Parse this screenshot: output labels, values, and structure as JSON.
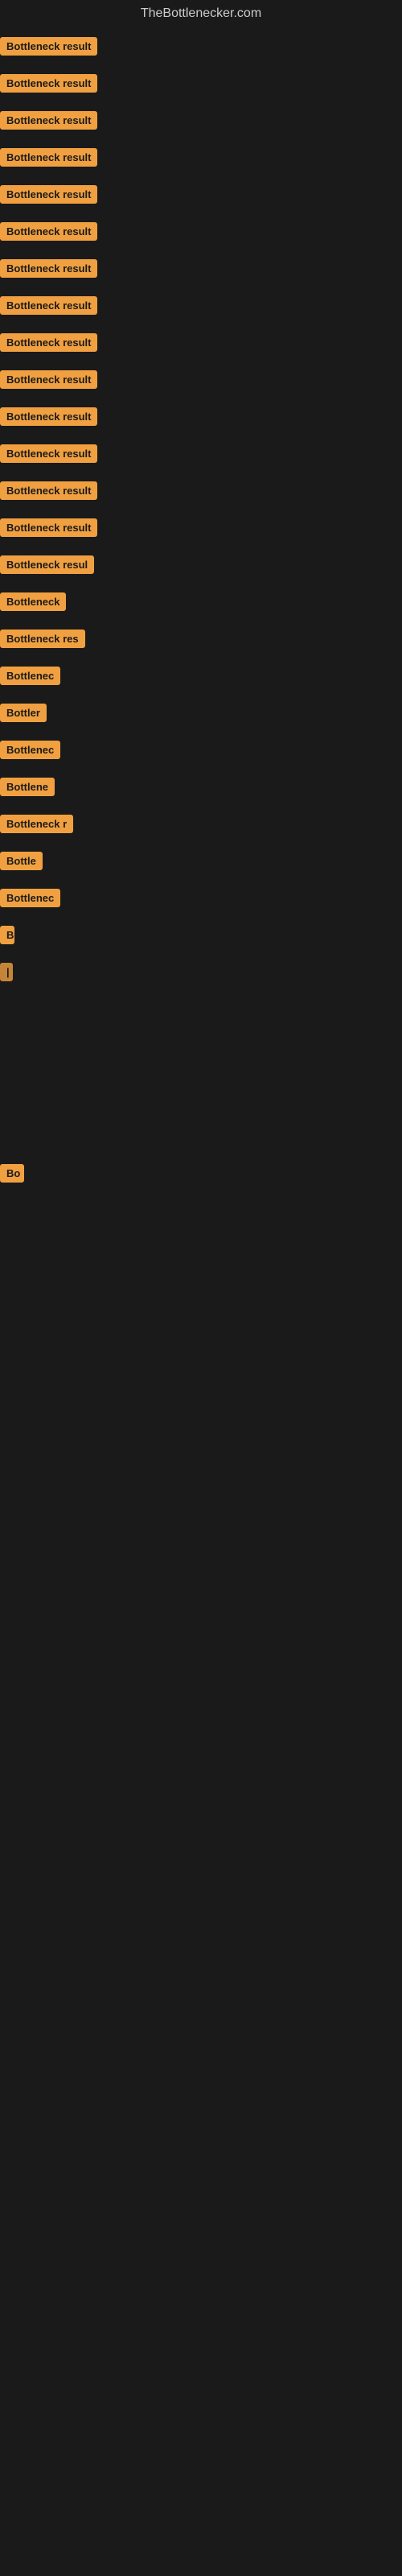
{
  "site": {
    "title": "TheBottlenecker.com"
  },
  "items": [
    {
      "id": 1,
      "label": "Bottleneck result"
    },
    {
      "id": 2,
      "label": "Bottleneck result"
    },
    {
      "id": 3,
      "label": "Bottleneck result"
    },
    {
      "id": 4,
      "label": "Bottleneck result"
    },
    {
      "id": 5,
      "label": "Bottleneck result"
    },
    {
      "id": 6,
      "label": "Bottleneck result"
    },
    {
      "id": 7,
      "label": "Bottleneck result"
    },
    {
      "id": 8,
      "label": "Bottleneck result"
    },
    {
      "id": 9,
      "label": "Bottleneck result"
    },
    {
      "id": 10,
      "label": "Bottleneck result"
    },
    {
      "id": 11,
      "label": "Bottleneck result"
    },
    {
      "id": 12,
      "label": "Bottleneck result"
    },
    {
      "id": 13,
      "label": "Bottleneck result"
    },
    {
      "id": 14,
      "label": "Bottleneck result"
    },
    {
      "id": 15,
      "label": "Bottleneck resul"
    },
    {
      "id": 16,
      "label": "Bottleneck"
    },
    {
      "id": 17,
      "label": "Bottleneck res"
    },
    {
      "id": 18,
      "label": "Bottlenec"
    },
    {
      "id": 19,
      "label": "Bottler"
    },
    {
      "id": 20,
      "label": "Bottlenec"
    },
    {
      "id": 21,
      "label": "Bottlene"
    },
    {
      "id": 22,
      "label": "Bottleneck r"
    },
    {
      "id": 23,
      "label": "Bottle"
    },
    {
      "id": 24,
      "label": "Bottlenec"
    },
    {
      "id": 25,
      "label": "B"
    },
    {
      "id": 26,
      "label": "|"
    }
  ],
  "late_item": {
    "label": "Bo"
  }
}
